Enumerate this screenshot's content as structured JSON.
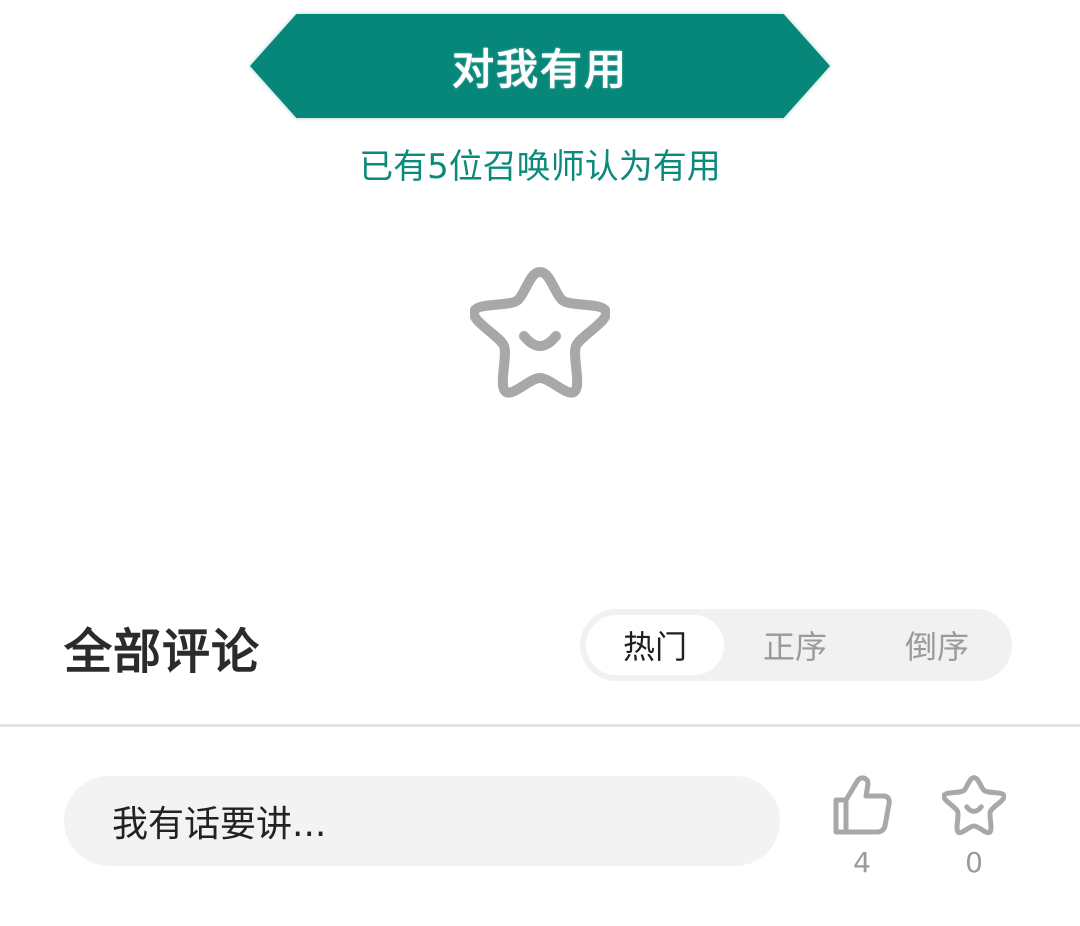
{
  "useful": {
    "button_label": "对我有用",
    "count_text": "已有5位召唤师认为有用"
  },
  "comments": {
    "title": "全部评论",
    "sort_tabs": [
      {
        "label": "热门",
        "active": true
      },
      {
        "label": "正序",
        "active": false
      },
      {
        "label": "倒序",
        "active": false
      }
    ],
    "input_placeholder": "我有话要讲..."
  },
  "actions": {
    "like_count": "4",
    "favorite_count": "0"
  },
  "colors": {
    "accent": "#06877A",
    "accent_text": "#0B8A7B",
    "icon_gray": "#A8A8A8",
    "muted_text": "#9A9A9A"
  },
  "icons": {
    "center": "star-smile-icon",
    "like": "thumbs-up-icon",
    "favorite": "star-smile-icon"
  }
}
